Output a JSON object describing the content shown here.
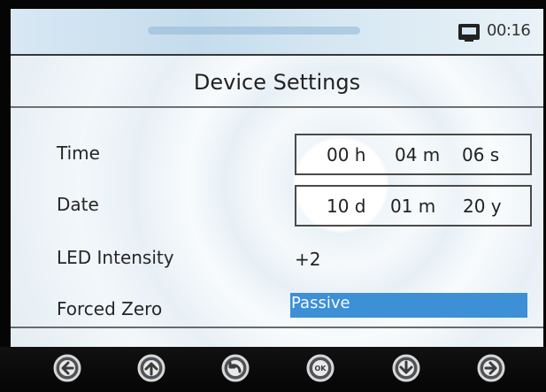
{
  "status_bar": {
    "time": "00:16",
    "battery_icon": "battery-icon"
  },
  "page": {
    "title": "Device Settings"
  },
  "settings": {
    "time": {
      "label": "Time",
      "hours": "00 h",
      "minutes": "04 m",
      "seconds": "06 s"
    },
    "date": {
      "label": "Date",
      "day": "10 d",
      "month": "01 m",
      "year": "20 y"
    },
    "led_intensity": {
      "label": "LED Intensity",
      "value": "+2"
    },
    "forced_zero": {
      "label": "Forced Zero",
      "value": "Passive"
    }
  },
  "navigation": {
    "buttons": [
      {
        "icon": "left-arrow-icon"
      },
      {
        "icon": "up-arrow-icon"
      },
      {
        "icon": "back-icon"
      },
      {
        "icon": "ok-icon",
        "label": "OK"
      },
      {
        "icon": "down-arrow-icon"
      },
      {
        "icon": "right-arrow-icon"
      }
    ]
  },
  "colors": {
    "selection": "#3d8fd6",
    "screen_background": "#eef5f9",
    "nav_background": "#080808"
  }
}
